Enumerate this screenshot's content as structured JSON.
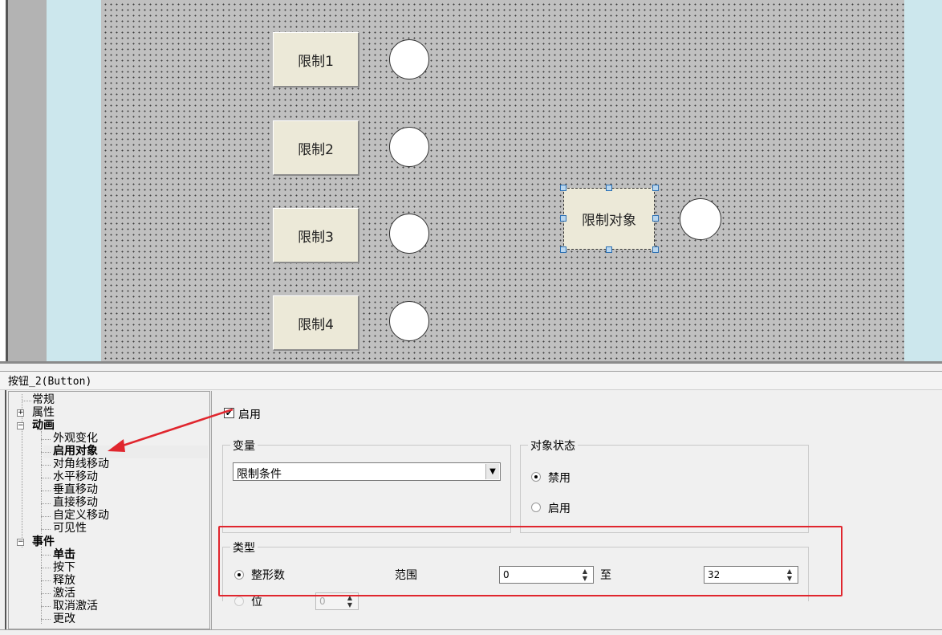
{
  "canvas": {
    "buttons": [
      {
        "label": "限制1"
      },
      {
        "label": "限制2"
      },
      {
        "label": "限制3"
      },
      {
        "label": "限制4"
      }
    ],
    "selected_button_label": "限制对象"
  },
  "properties": {
    "title": "按钮_2(Button)",
    "tree": [
      {
        "label": "常规",
        "bold": false
      },
      {
        "label": "属性",
        "bold": false,
        "expander": "+"
      },
      {
        "label": "动画",
        "bold": true,
        "expander": "−"
      },
      {
        "label": "外观变化",
        "bold": false
      },
      {
        "label": "启用对象",
        "bold": true,
        "selected": true
      },
      {
        "label": "对角线移动",
        "bold": false
      },
      {
        "label": "水平移动",
        "bold": false
      },
      {
        "label": "垂直移动",
        "bold": false
      },
      {
        "label": "直接移动",
        "bold": false
      },
      {
        "label": "自定义移动",
        "bold": false
      },
      {
        "label": "可见性",
        "bold": false
      },
      {
        "label": "事件",
        "bold": true,
        "expander": "−"
      },
      {
        "label": "单击",
        "bold": true
      },
      {
        "label": "按下",
        "bold": false
      },
      {
        "label": "释放",
        "bold": false
      },
      {
        "label": "激活",
        "bold": false
      },
      {
        "label": "取消激活",
        "bold": false
      },
      {
        "label": "更改",
        "bold": false
      }
    ],
    "enable_checkbox": {
      "label": "启用",
      "checked": true
    },
    "variable_group": {
      "title": "变量",
      "selected": "限制条件"
    },
    "state_group": {
      "title": "对象状态",
      "options": [
        {
          "label": "禁用",
          "checked": true
        },
        {
          "label": "启用",
          "checked": false
        }
      ]
    },
    "type_group": {
      "title": "类型",
      "integer_label": "整形数",
      "range_label": "范围",
      "to_label": "至",
      "range_from": "0",
      "range_to": "32",
      "bit_label": "位",
      "bit_value": "0"
    },
    "annotation_color": "#e0262e"
  }
}
